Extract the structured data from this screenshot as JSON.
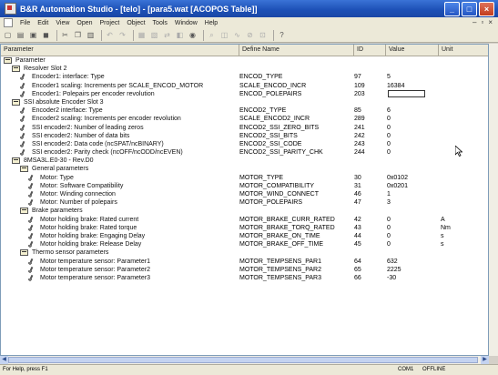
{
  "window": {
    "title": "B&R Automation Studio - [telo] - [para5.wat [ACOPOS Table]]"
  },
  "menu": [
    "File",
    "Edit",
    "View",
    "Open",
    "Project",
    "Object",
    "Tools",
    "Window",
    "Help"
  ],
  "columns": [
    "Parameter",
    "Define Name",
    "ID",
    "Value",
    "Unit"
  ],
  "rows": [
    {
      "indent": 0,
      "kind": "tree",
      "label": "Parameter"
    },
    {
      "indent": 1,
      "kind": "tree",
      "label": "Resolver Slot 2"
    },
    {
      "indent": 2,
      "kind": "param",
      "label": "Encoder1: interface: Type",
      "define": "ENCOD_TYPE",
      "id": "97",
      "value": "5"
    },
    {
      "indent": 2,
      "kind": "param",
      "label": "Encoder1 scaling: Increments per SCALE_ENCOD_MOTOR",
      "define": "SCALE_ENCOD_INCR",
      "id": "109",
      "value": "16384"
    },
    {
      "indent": 2,
      "kind": "param",
      "label": "Encoder1: Polepairs per encoder revolution",
      "define": "ENCOD_POLEPAIRS",
      "id": "203",
      "value": "",
      "editing": true
    },
    {
      "indent": 1,
      "kind": "tree",
      "label": "SSI absolute Encoder Slot 3"
    },
    {
      "indent": 2,
      "kind": "param",
      "label": "Encoder2 interface: Type",
      "define": "ENCOD2_TYPE",
      "id": "85",
      "value": "6"
    },
    {
      "indent": 2,
      "kind": "param",
      "label": "Encoder2 scaling: Increments per encoder revolution",
      "define": "SCALE_ENCOD2_INCR",
      "id": "289",
      "value": "0"
    },
    {
      "indent": 2,
      "kind": "param",
      "label": "SSI encoder2: Number of leading zeros",
      "define": "ENCOD2_SSI_ZERO_BITS",
      "id": "241",
      "value": "0"
    },
    {
      "indent": 2,
      "kind": "param",
      "label": "SSI encoder2: Number of data bits",
      "define": "ENCOD2_SSI_BITS",
      "id": "242",
      "value": "0"
    },
    {
      "indent": 2,
      "kind": "param",
      "label": "SSI encoder2: Data code (ncSPAT/ncBINARY)",
      "define": "ENCOD2_SSI_CODE",
      "id": "243",
      "value": "0"
    },
    {
      "indent": 2,
      "kind": "param",
      "label": "SSI encoder2: Parity check (ncOFF/ncODD/ncEVEN)",
      "define": "ENCOD2_SSI_PARITY_CHK",
      "id": "244",
      "value": "0"
    },
    {
      "indent": 1,
      "kind": "tree",
      "label": "8MSA3L.E0-30 - Rev.D0"
    },
    {
      "indent": 2,
      "kind": "tree",
      "label": "General parameters"
    },
    {
      "indent": 3,
      "kind": "param",
      "label": "Motor: Type",
      "define": "MOTOR_TYPE",
      "id": "30",
      "value": "0x0102"
    },
    {
      "indent": 3,
      "kind": "param",
      "label": "Motor: Software Compatibility",
      "define": "MOTOR_COMPATIBILITY",
      "id": "31",
      "value": "0x0201"
    },
    {
      "indent": 3,
      "kind": "param",
      "label": "Motor: Winding connection",
      "define": "MOTOR_WIND_CONNECT",
      "id": "46",
      "value": "1"
    },
    {
      "indent": 3,
      "kind": "param",
      "label": "Motor: Number of polepairs",
      "define": "MOTOR_POLEPAIRS",
      "id": "47",
      "value": "3"
    },
    {
      "indent": 2,
      "kind": "tree",
      "label": "Brake parameters"
    },
    {
      "indent": 3,
      "kind": "param",
      "label": "Motor holding brake: Rated current",
      "define": "MOTOR_BRAKE_CURR_RATED",
      "id": "42",
      "value": "0",
      "unit": "A"
    },
    {
      "indent": 3,
      "kind": "param",
      "label": "Motor holding brake: Rated torque",
      "define": "MOTOR_BRAKE_TORQ_RATED",
      "id": "43",
      "value": "0",
      "unit": "Nm"
    },
    {
      "indent": 3,
      "kind": "param",
      "label": "Motor holding brake: Engaging Delay",
      "define": "MOTOR_BRAKE_ON_TIME",
      "id": "44",
      "value": "0",
      "unit": "s"
    },
    {
      "indent": 3,
      "kind": "param",
      "label": "Motor holding brake: Release Delay",
      "define": "MOTOR_BRAKE_OFF_TIME",
      "id": "45",
      "value": "0",
      "unit": "s"
    },
    {
      "indent": 2,
      "kind": "tree",
      "label": "Thermo sensor parameters"
    },
    {
      "indent": 3,
      "kind": "param",
      "label": "Motor temperature sensor: Parameter1",
      "define": "MOTOR_TEMPSENS_PAR1",
      "id": "64",
      "value": "632"
    },
    {
      "indent": 3,
      "kind": "param",
      "label": "Motor temperature sensor: Parameter2",
      "define": "MOTOR_TEMPSENS_PAR2",
      "id": "65",
      "value": "2225"
    },
    {
      "indent": 3,
      "kind": "param",
      "label": "Motor temperature sensor: Parameter3",
      "define": "MOTOR_TEMPSENS_PAR3",
      "id": "66",
      "value": "-30"
    }
  ],
  "status": {
    "help": "For Help, press F1",
    "com": "COM1",
    "mode": "OFFLINE"
  }
}
